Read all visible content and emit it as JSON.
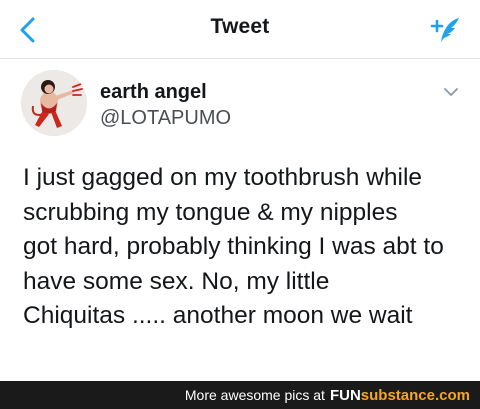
{
  "header": {
    "title": "Tweet",
    "back_icon": "chevron-left-icon",
    "compose_icon": "compose-tweet-icon",
    "accent_color": "#1da1f2"
  },
  "tweet": {
    "display_name": "earth angel",
    "handle": "@LOTAPUMO",
    "menu_icon": "chevron-down-icon",
    "text": "I just gagged on my toothbrush while\nscrubbing my tongue & my nipples\ngot hard, probably thinking I was abt to\nhave some sex. No, my little\nChiquitas ..... another moon we wait"
  },
  "footer": {
    "caption": "More awesome pics at",
    "brand_part1": "FUN",
    "brand_part2": "substance.com",
    "brand_color": "#f5a623"
  }
}
